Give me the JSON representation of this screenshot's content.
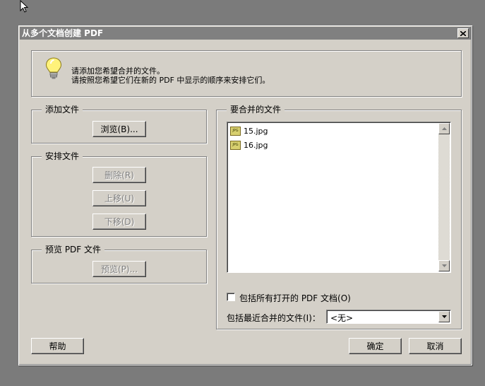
{
  "dialog": {
    "title": "从多个文档创建 PDF",
    "close_glyph": "✕"
  },
  "info": {
    "line1": "请添加您希望合并的文件。",
    "line2": "请按照您希望它们在新的 PDF 中显示的顺序来安排它们。"
  },
  "add_files": {
    "legend": "添加文件",
    "browse_label": "浏览(B)..."
  },
  "arrange": {
    "legend": "安排文件",
    "remove_label": "删除(R)",
    "move_up_label": "上移(U)",
    "move_down_label": "下移(D)"
  },
  "preview": {
    "legend": "预览 PDF 文件",
    "preview_label": "预览(P)..."
  },
  "merge_list": {
    "legend": "要合并的文件",
    "files": [
      {
        "name": "15.jpg",
        "icon": "jpg-file-icon",
        "icon_text": "JPG"
      },
      {
        "name": "16.jpg",
        "icon": "jpg-file-icon",
        "icon_text": "JPG"
      }
    ]
  },
  "options": {
    "include_open_label": "包括所有打开的 PDF 文档(O)",
    "include_open_checked": false,
    "recent_label": "包括最近合并的文件(I)：",
    "recent_value": "<无>"
  },
  "footer": {
    "help_label": "帮助",
    "ok_label": "确定",
    "cancel_label": "取消"
  }
}
